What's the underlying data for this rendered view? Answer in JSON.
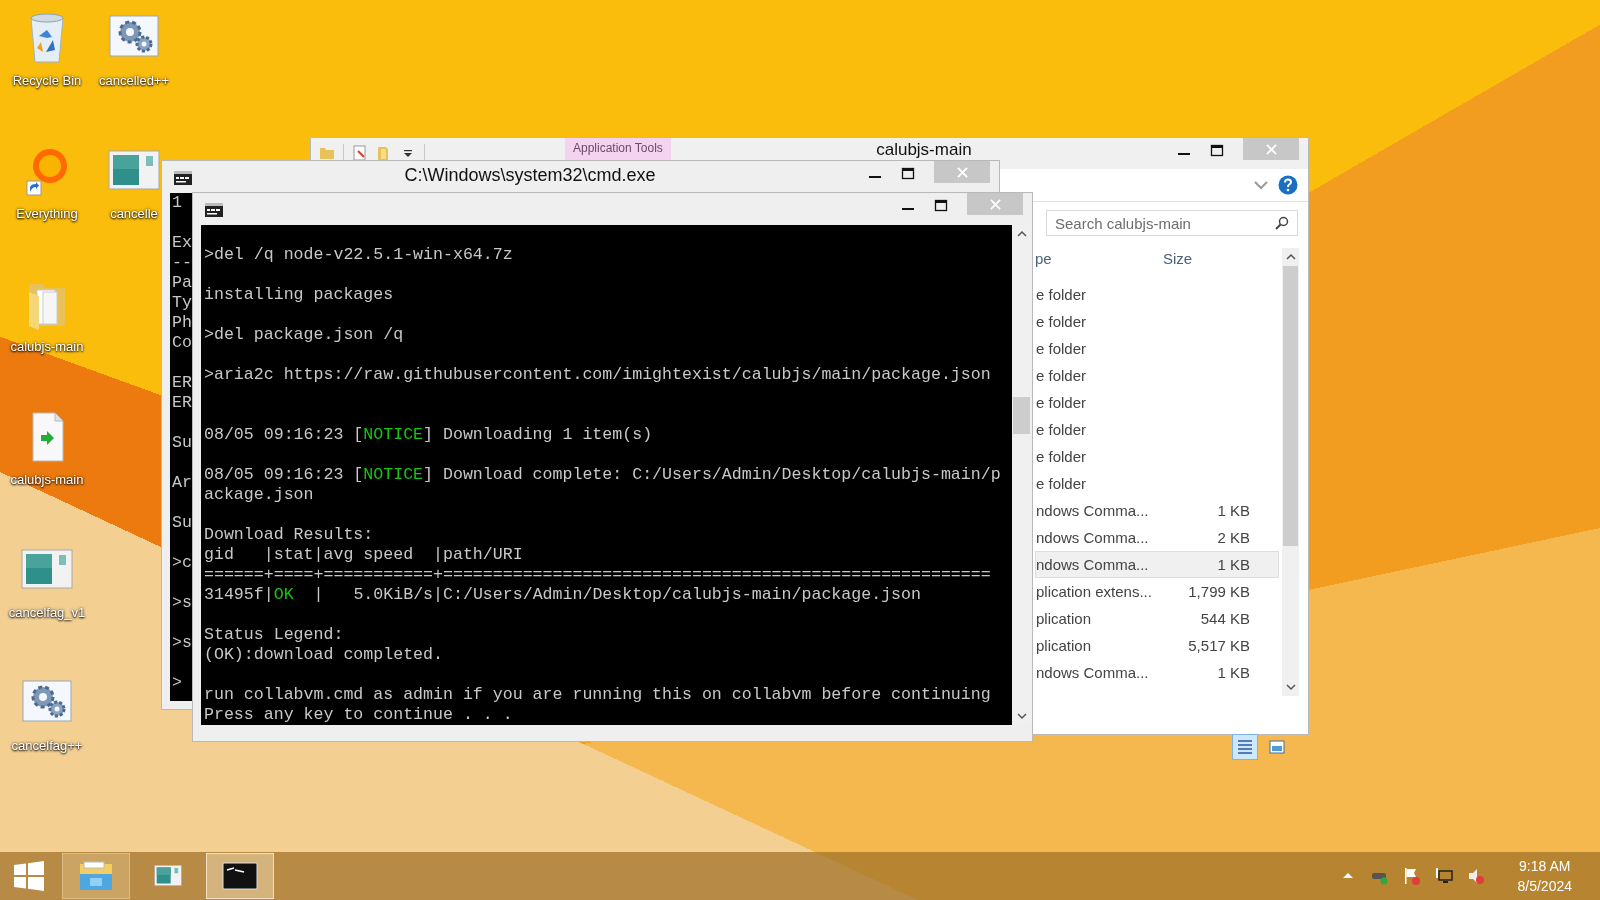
{
  "desktop_icons": [
    {
      "label": "Recycle Bin",
      "kind": "recycle-bin"
    },
    {
      "label": "Everything",
      "kind": "ring-shortcut"
    },
    {
      "label": "calubjs-main",
      "kind": "folder"
    },
    {
      "label": "calubjs-main",
      "kind": "script-file"
    },
    {
      "label": "cancelfag_v1",
      "kind": "app-window"
    },
    {
      "label": "cancelfag++",
      "kind": "gear"
    },
    {
      "label": "cancelled++",
      "kind": "gear"
    },
    {
      "label": "cancelle",
      "kind": "app-window"
    }
  ],
  "explorer": {
    "title": "calubjs-main",
    "context_tab": "Application Tools",
    "search": {
      "placeholder": "Search calubjs-main"
    },
    "columns": [
      "pe",
      "Size"
    ],
    "rows": [
      {
        "type": "e folder",
        "selected": false
      },
      {
        "type": "e folder",
        "selected": false
      },
      {
        "type": "e folder",
        "selected": false
      },
      {
        "type": "e folder",
        "selected": false
      },
      {
        "type": "e folder",
        "selected": false
      },
      {
        "type": "e folder",
        "selected": false
      },
      {
        "type": "e folder",
        "selected": false
      },
      {
        "type": "e folder",
        "selected": false
      },
      {
        "type": "ndows Comma...",
        "size": "1 KB",
        "selected": false
      },
      {
        "type": "ndows Comma...",
        "size": "2 KB",
        "selected": false
      },
      {
        "type": "ndows Comma...",
        "size": "1 KB",
        "selected": true
      },
      {
        "type": "plication extens...",
        "size": "1,799 KB",
        "selected": false
      },
      {
        "type": "plication",
        "size": "544 KB",
        "selected": false
      },
      {
        "type": "plication",
        "size": "5,517 KB",
        "selected": false
      },
      {
        "type": "ndows Comma...",
        "size": "1 KB",
        "selected": false
      }
    ]
  },
  "back_console": {
    "title": "C:\\Windows\\system32\\cmd.exe",
    "blocks": [
      {
        "lines": [
          "1"
        ]
      },
      {
        "lines": [
          "Ex",
          "--",
          "Pa",
          "Ty",
          "Ph",
          "Co"
        ]
      },
      {
        "lines": [
          "ER",
          "ER"
        ]
      },
      {
        "lines": [
          "Su"
        ]
      },
      {
        "lines": [
          "Ar"
        ]
      },
      {
        "lines": [
          "Su"
        ]
      },
      {
        "lines": [
          ">c"
        ]
      },
      {
        "lines": [
          ">s"
        ]
      },
      {
        "lines": [
          ">s"
        ]
      },
      {
        "lines": [
          ">"
        ]
      }
    ]
  },
  "front_console": {
    "blocks": [
      {
        "wide_gap": false,
        "lines": [
          {
            "spans": [
              {
                "text": ">del /q node-v22.5.1-win-x64.7z"
              }
            ]
          }
        ]
      },
      {
        "wide_gap": false,
        "lines": [
          {
            "spans": [
              {
                "text": "installing packages"
              }
            ]
          }
        ]
      },
      {
        "wide_gap": false,
        "lines": [
          {
            "spans": [
              {
                "text": ">del package.json /q"
              }
            ]
          }
        ]
      },
      {
        "wide_gap": false,
        "lines": [
          {
            "spans": [
              {
                "text": ">aria2c https://raw.githubusercontent.com/imightexist/calubjs/main/package.json"
              }
            ]
          }
        ]
      },
      {
        "wide_gap": true,
        "lines": [
          {
            "spans": [
              {
                "text": "08/05 09:16:23 ["
              },
              {
                "text": "NOTICE",
                "color": "#16c60c"
              },
              {
                "text": "] Downloading 1 item(s)"
              }
            ]
          }
        ]
      },
      {
        "wide_gap": false,
        "lines": [
          {
            "spans": [
              {
                "text": "08/05 09:16:23 ["
              },
              {
                "text": "NOTICE",
                "color": "#16c60c"
              },
              {
                "text": "] Download complete: C:/Users/Admin/Desktop/calubjs-main/p"
              }
            ]
          },
          {
            "spans": [
              {
                "text": "ackage.json"
              }
            ]
          }
        ]
      },
      {
        "wide_gap": false,
        "lines": [
          {
            "spans": [
              {
                "text": "Download Results:"
              }
            ]
          },
          {
            "spans": [
              {
                "text": "gid   |stat|avg speed  |path/URI"
              }
            ]
          },
          {
            "spans": [
              {
                "text": "======+====+===========+======================================================="
              }
            ]
          },
          {
            "spans": [
              {
                "text": "31495f|"
              },
              {
                "text": "OK",
                "color": "#16c60c"
              },
              {
                "text": "  |   5.0KiB/s|C:/Users/Admin/Desktop/calubjs-main/package.json"
              }
            ]
          }
        ]
      },
      {
        "wide_gap": false,
        "lines": [
          {
            "spans": [
              {
                "text": "Status Legend:"
              }
            ]
          },
          {
            "spans": [
              {
                "text": "(OK):download completed."
              }
            ]
          }
        ]
      },
      {
        "wide_gap": false,
        "lines": [
          {
            "spans": [
              {
                "text": "run collabvm.cmd as admin if you are running this on collabvm before continuing"
              }
            ]
          },
          {
            "spans": [
              {
                "text": "Press any key to continue . . ."
              }
            ]
          }
        ]
      }
    ]
  },
  "taskbar": {
    "items": [
      {
        "kind": "start"
      },
      {
        "kind": "explorer",
        "running": true,
        "selected": false
      },
      {
        "kind": "app-window",
        "running": false,
        "selected": false
      },
      {
        "kind": "console",
        "running": true,
        "selected": true
      }
    ],
    "time": "9:18 AM",
    "date": "8/5/2024"
  }
}
